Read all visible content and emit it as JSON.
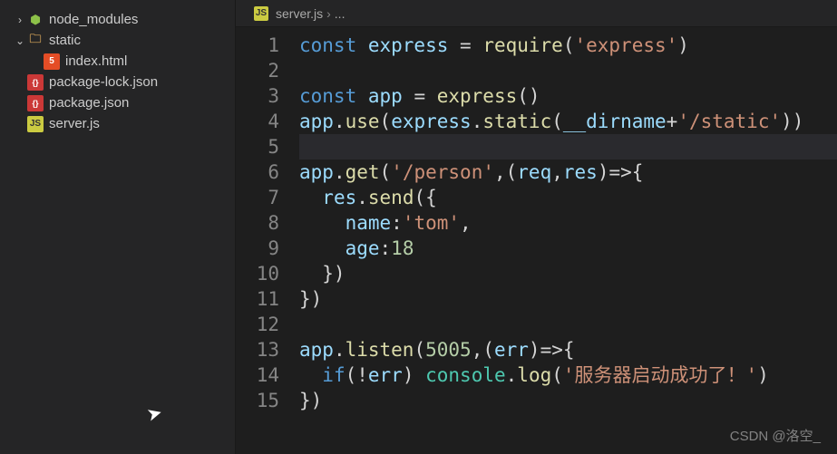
{
  "sidebar": {
    "items": [
      {
        "label": "node_modules",
        "kind": "nm",
        "arrow": "chevron-right",
        "depth": 1
      },
      {
        "label": "static",
        "kind": "folder",
        "arrow": "chevron-down",
        "depth": 1
      },
      {
        "label": "index.html",
        "kind": "html",
        "arrow": "",
        "depth": 2
      },
      {
        "label": "package-lock.json",
        "kind": "json",
        "arrow": "",
        "depth": 1
      },
      {
        "label": "package.json",
        "kind": "json",
        "arrow": "",
        "depth": 1
      },
      {
        "label": "server.js",
        "kind": "js",
        "arrow": "",
        "depth": 1
      }
    ]
  },
  "tab": {
    "filename": "server.js",
    "crumb_tail": "..."
  },
  "code": {
    "lines": [
      {
        "n": "1",
        "tokens": [
          [
            "kw",
            "const "
          ],
          [
            "var",
            "express"
          ],
          [
            "",
            " = "
          ],
          [
            "fn",
            "require"
          ],
          [
            "",
            "("
          ],
          [
            "str",
            "'express'"
          ],
          [
            "",
            ")"
          ]
        ]
      },
      {
        "n": "2",
        "tokens": []
      },
      {
        "n": "3",
        "tokens": [
          [
            "kw",
            "const "
          ],
          [
            "var",
            "app"
          ],
          [
            "",
            " = "
          ],
          [
            "fn",
            "express"
          ],
          [
            "",
            "()"
          ]
        ]
      },
      {
        "n": "4",
        "tokens": [
          [
            "var",
            "app"
          ],
          [
            "",
            "."
          ],
          [
            "fn",
            "use"
          ],
          [
            "",
            "("
          ],
          [
            "var",
            "express"
          ],
          [
            "",
            "."
          ],
          [
            "fn",
            "static"
          ],
          [
            "",
            "("
          ],
          [
            "var",
            "__dirname"
          ],
          [
            "",
            "+"
          ],
          [
            "str",
            "'/static'"
          ],
          [
            "",
            "))"
          ]
        ]
      },
      {
        "n": "5",
        "tokens": [],
        "active": true
      },
      {
        "n": "6",
        "tokens": [
          [
            "var",
            "app"
          ],
          [
            "",
            "."
          ],
          [
            "fn",
            "get"
          ],
          [
            "",
            "("
          ],
          [
            "str",
            "'/person'"
          ],
          [
            "",
            ",("
          ],
          [
            "var",
            "req"
          ],
          [
            "",
            ","
          ],
          [
            "var",
            "res"
          ],
          [
            "",
            ")=>{"
          ]
        ]
      },
      {
        "n": "7",
        "tokens": [
          [
            "",
            "  "
          ],
          [
            "var",
            "res"
          ],
          [
            "",
            "."
          ],
          [
            "fn",
            "send"
          ],
          [
            "",
            "({"
          ]
        ]
      },
      {
        "n": "8",
        "tokens": [
          [
            "",
            "    "
          ],
          [
            "prop",
            "name"
          ],
          [
            "",
            ":"
          ],
          [
            "str",
            "'tom'"
          ],
          [
            "",
            ","
          ]
        ]
      },
      {
        "n": "9",
        "tokens": [
          [
            "",
            "    "
          ],
          [
            "prop",
            "age"
          ],
          [
            "",
            ":"
          ],
          [
            "num",
            "18"
          ]
        ]
      },
      {
        "n": "10",
        "tokens": [
          [
            "",
            "  })"
          ]
        ]
      },
      {
        "n": "11",
        "tokens": [
          [
            "",
            "})"
          ]
        ]
      },
      {
        "n": "12",
        "tokens": []
      },
      {
        "n": "13",
        "tokens": [
          [
            "var",
            "app"
          ],
          [
            "",
            "."
          ],
          [
            "fn",
            "listen"
          ],
          [
            "",
            "("
          ],
          [
            "num",
            "5005"
          ],
          [
            "",
            ",("
          ],
          [
            "var",
            "err"
          ],
          [
            "",
            ")=>{"
          ]
        ]
      },
      {
        "n": "14",
        "tokens": [
          [
            "",
            "  "
          ],
          [
            "kw",
            "if"
          ],
          [
            "",
            "(!"
          ],
          [
            "var",
            "err"
          ],
          [
            "",
            ") "
          ],
          [
            "obj",
            "console"
          ],
          [
            "",
            "."
          ],
          [
            "fn",
            "log"
          ],
          [
            "",
            "("
          ],
          [
            "str",
            "'服务器启动成功了！'"
          ],
          [
            "",
            ")"
          ]
        ]
      },
      {
        "n": "15",
        "tokens": [
          [
            "",
            "})"
          ]
        ]
      }
    ]
  },
  "watermark": "CSDN @洛空_",
  "icon_glyph": {
    "nm": "⬢",
    "folder": "🗀",
    "html": "5",
    "json": "{}",
    "js": "JS"
  },
  "arrow_glyph": {
    "chevron-right": "›",
    "chevron-down": "⌄",
    "": ""
  }
}
